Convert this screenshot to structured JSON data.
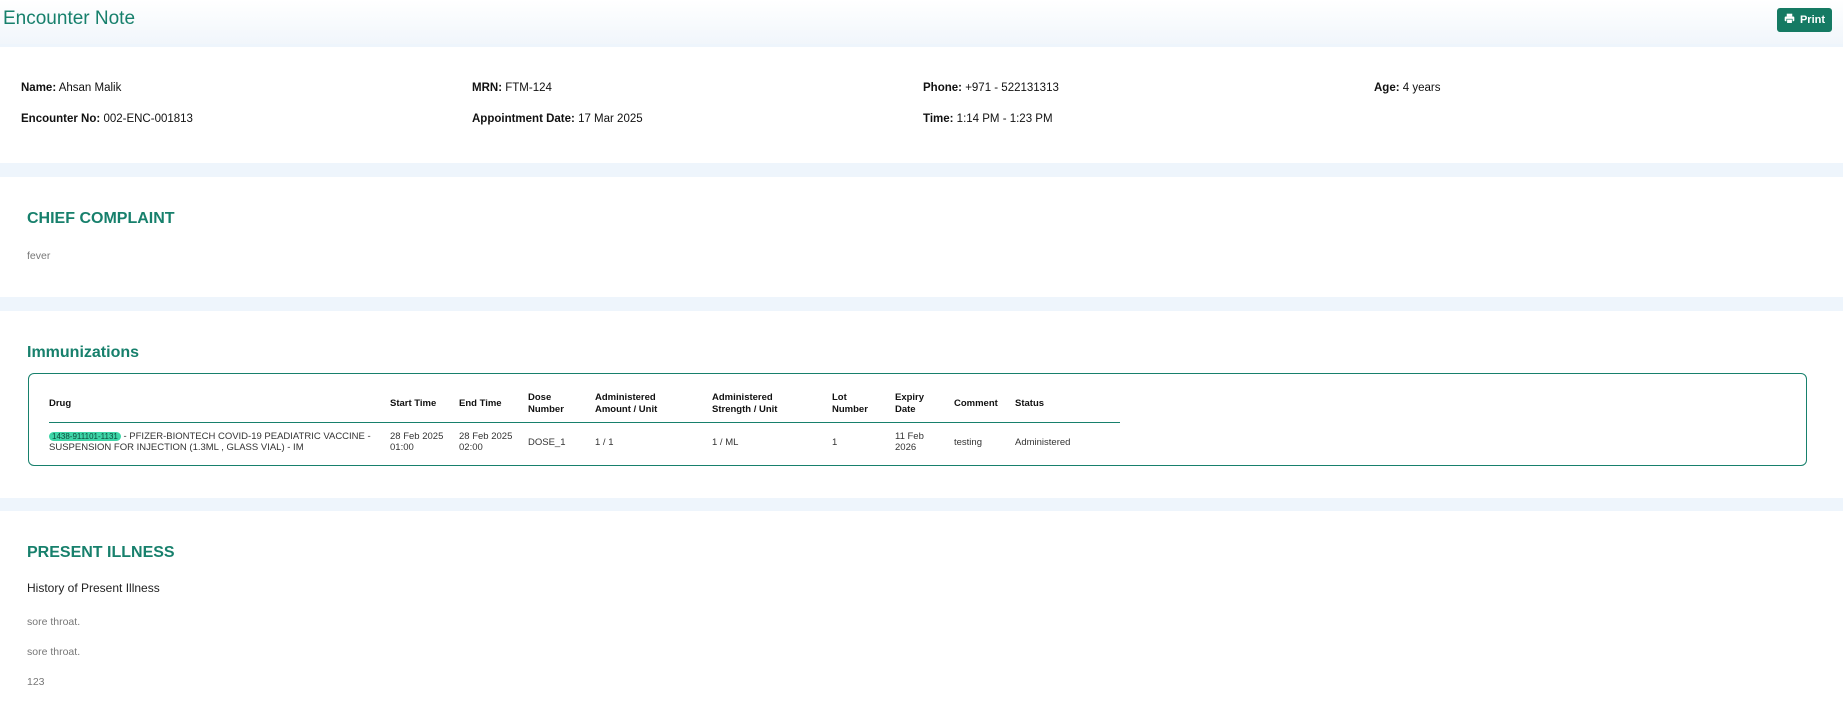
{
  "header": {
    "title": "Encounter Note",
    "print_label": "Print",
    "print_icon": "print-icon"
  },
  "patient": {
    "name_label": "Name:",
    "name": "Ahsan Malik",
    "mrn_label": "MRN:",
    "mrn": "FTM-124",
    "phone_label": "Phone:",
    "phone": "+971 - 522131313",
    "age_label": "Age:",
    "age": "4 years",
    "encounter_label": "Encounter No:",
    "encounter": "002-ENC-001813",
    "appt_label": "Appointment Date:",
    "appt": "17 Mar 2025",
    "time_label": "Time:",
    "time": "1:14 PM - 1:23 PM"
  },
  "chief_complaint": {
    "title": "CHIEF COMPLAINT",
    "text": "fever"
  },
  "immunizations": {
    "title": "Immunizations",
    "headers": {
      "drug": "Drug",
      "start": "Start Time",
      "end": "End Time",
      "dose_1": "Dose",
      "dose_2": "Number",
      "amount_1": "Administered",
      "amount_2": "Amount / Unit",
      "strength_1": "Administered",
      "strength_2": "Strength / Unit",
      "lot_1": "Lot",
      "lot_2": "Number",
      "expiry_1": "Expiry",
      "expiry_2": "Date",
      "comment": "Comment",
      "status": "Status"
    },
    "rows": [
      {
        "code": "1438-911101-1131",
        "drug": " - PFIZER-BIONTECH COVID-19 PEADIATRIC VACCINE - SUSPENSION FOR INJECTION (1.3ML , GLASS VIAL) - IM",
        "start_date": "28 Feb 2025",
        "start_time": "01:00",
        "end_date": "28 Feb 2025",
        "end_time": "02:00",
        "dose": "DOSE_1",
        "amount": "1 / 1",
        "strength": "1 / ML",
        "lot": "1",
        "expiry_1": "11 Feb",
        "expiry_2": "2026",
        "comment": "testing",
        "status": "Administered"
      }
    ]
  },
  "present_illness": {
    "title": "PRESENT ILLNESS",
    "subtitle": "History of Present Illness",
    "lines": [
      "sore throat.",
      "sore throat.",
      "123"
    ]
  },
  "colors": {
    "accent": "#17806c",
    "button": "#157a63",
    "pill": "#3fd6a8",
    "page_bg": "#eef5fc"
  }
}
